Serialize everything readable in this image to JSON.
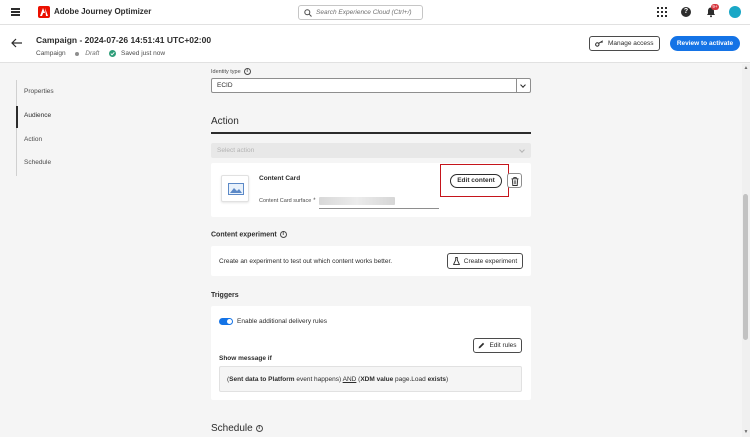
{
  "app": {
    "name": "Adobe Journey Optimizer"
  },
  "search": {
    "placeholder": "Search Experience Cloud (Ctrl+/)"
  },
  "notifications": {
    "count": "9+"
  },
  "header": {
    "title": "Campaign - 2024-07-26 14:51:41 UTC+02:00",
    "type": "Campaign",
    "status": "Draft",
    "saved": "Saved just now",
    "manage_access": "Manage access",
    "review_activate": "Review to activate"
  },
  "nav": {
    "items": [
      {
        "label": "Properties"
      },
      {
        "label": "Audience"
      },
      {
        "label": "Action"
      },
      {
        "label": "Schedule"
      }
    ]
  },
  "identity": {
    "label": "Identity type",
    "value": "ECID"
  },
  "action": {
    "title": "Action",
    "select_placeholder": "Select action",
    "card_title": "Content Card",
    "surface_label": "Content Card surface",
    "surface_required": "*",
    "edit_content": "Edit content"
  },
  "experiment": {
    "title": "Content experiment",
    "description": "Create an experiment to test out which content works better.",
    "button": "Create experiment"
  },
  "triggers": {
    "title": "Triggers",
    "toggle_label": "Enable additional delivery rules",
    "toggle_on": true,
    "edit_rules": "Edit rules",
    "show_message_if": "Show message if",
    "rule": {
      "open": "(",
      "part1_bold": "Sent data to Platform",
      "part1_rest": " event happens) ",
      "and": "AND",
      "part2_open": " (",
      "part2_bold": "XDM value",
      "part2_mid": " page.Load ",
      "part2_bold2": "exists",
      "close": ")"
    }
  },
  "schedule": {
    "title": "Schedule"
  },
  "colors": {
    "accent": "#1473e6",
    "brand": "#eb1000",
    "highlight": "#c5141b",
    "success": "#2d9d78"
  }
}
